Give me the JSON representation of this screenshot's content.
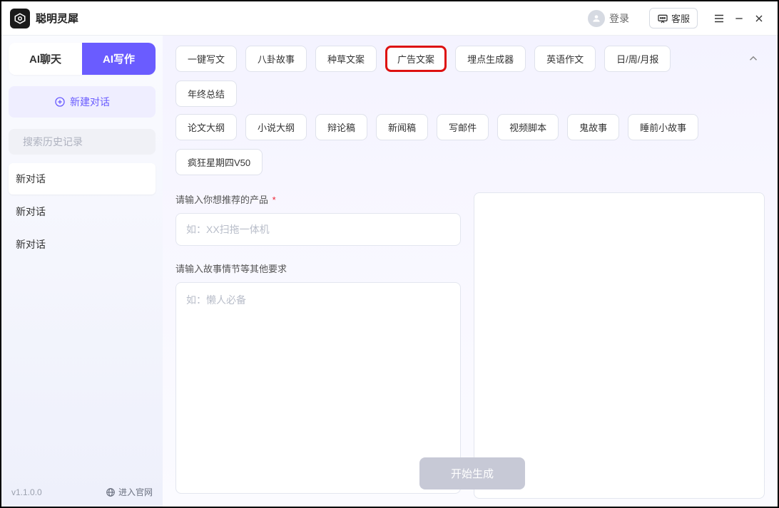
{
  "titlebar": {
    "app_name": "聪明灵犀",
    "login_label": "登录",
    "support_label": "客服"
  },
  "sidebar": {
    "tab_chat": "AI聊天",
    "tab_write": "AI写作",
    "new_chat": "新建对话",
    "search_placeholder": "搜索历史记录",
    "history": [
      "新对话",
      "新对话",
      "新对话"
    ],
    "version": "v1.1.0.0",
    "site_link": "进入官网"
  },
  "templates": {
    "row1": [
      "一键写文",
      "八卦故事",
      "种草文案",
      "广告文案",
      "埋点生成器",
      "英语作文",
      "日/周/月报",
      "年终总结"
    ],
    "row2": [
      "论文大纲",
      "小说大纲",
      "辩论稿",
      "新闻稿",
      "写邮件",
      "视频脚本",
      "鬼故事",
      "睡前小故事",
      "疯狂星期四V50"
    ],
    "selected": "广告文案"
  },
  "form": {
    "product_label": "请输入你想推荐的产品",
    "product_placeholder": "如：XX扫拖一体机",
    "story_label": "请输入故事情节等其他要求",
    "story_placeholder": "如：懒人必备",
    "generate_label": "开始生成"
  }
}
